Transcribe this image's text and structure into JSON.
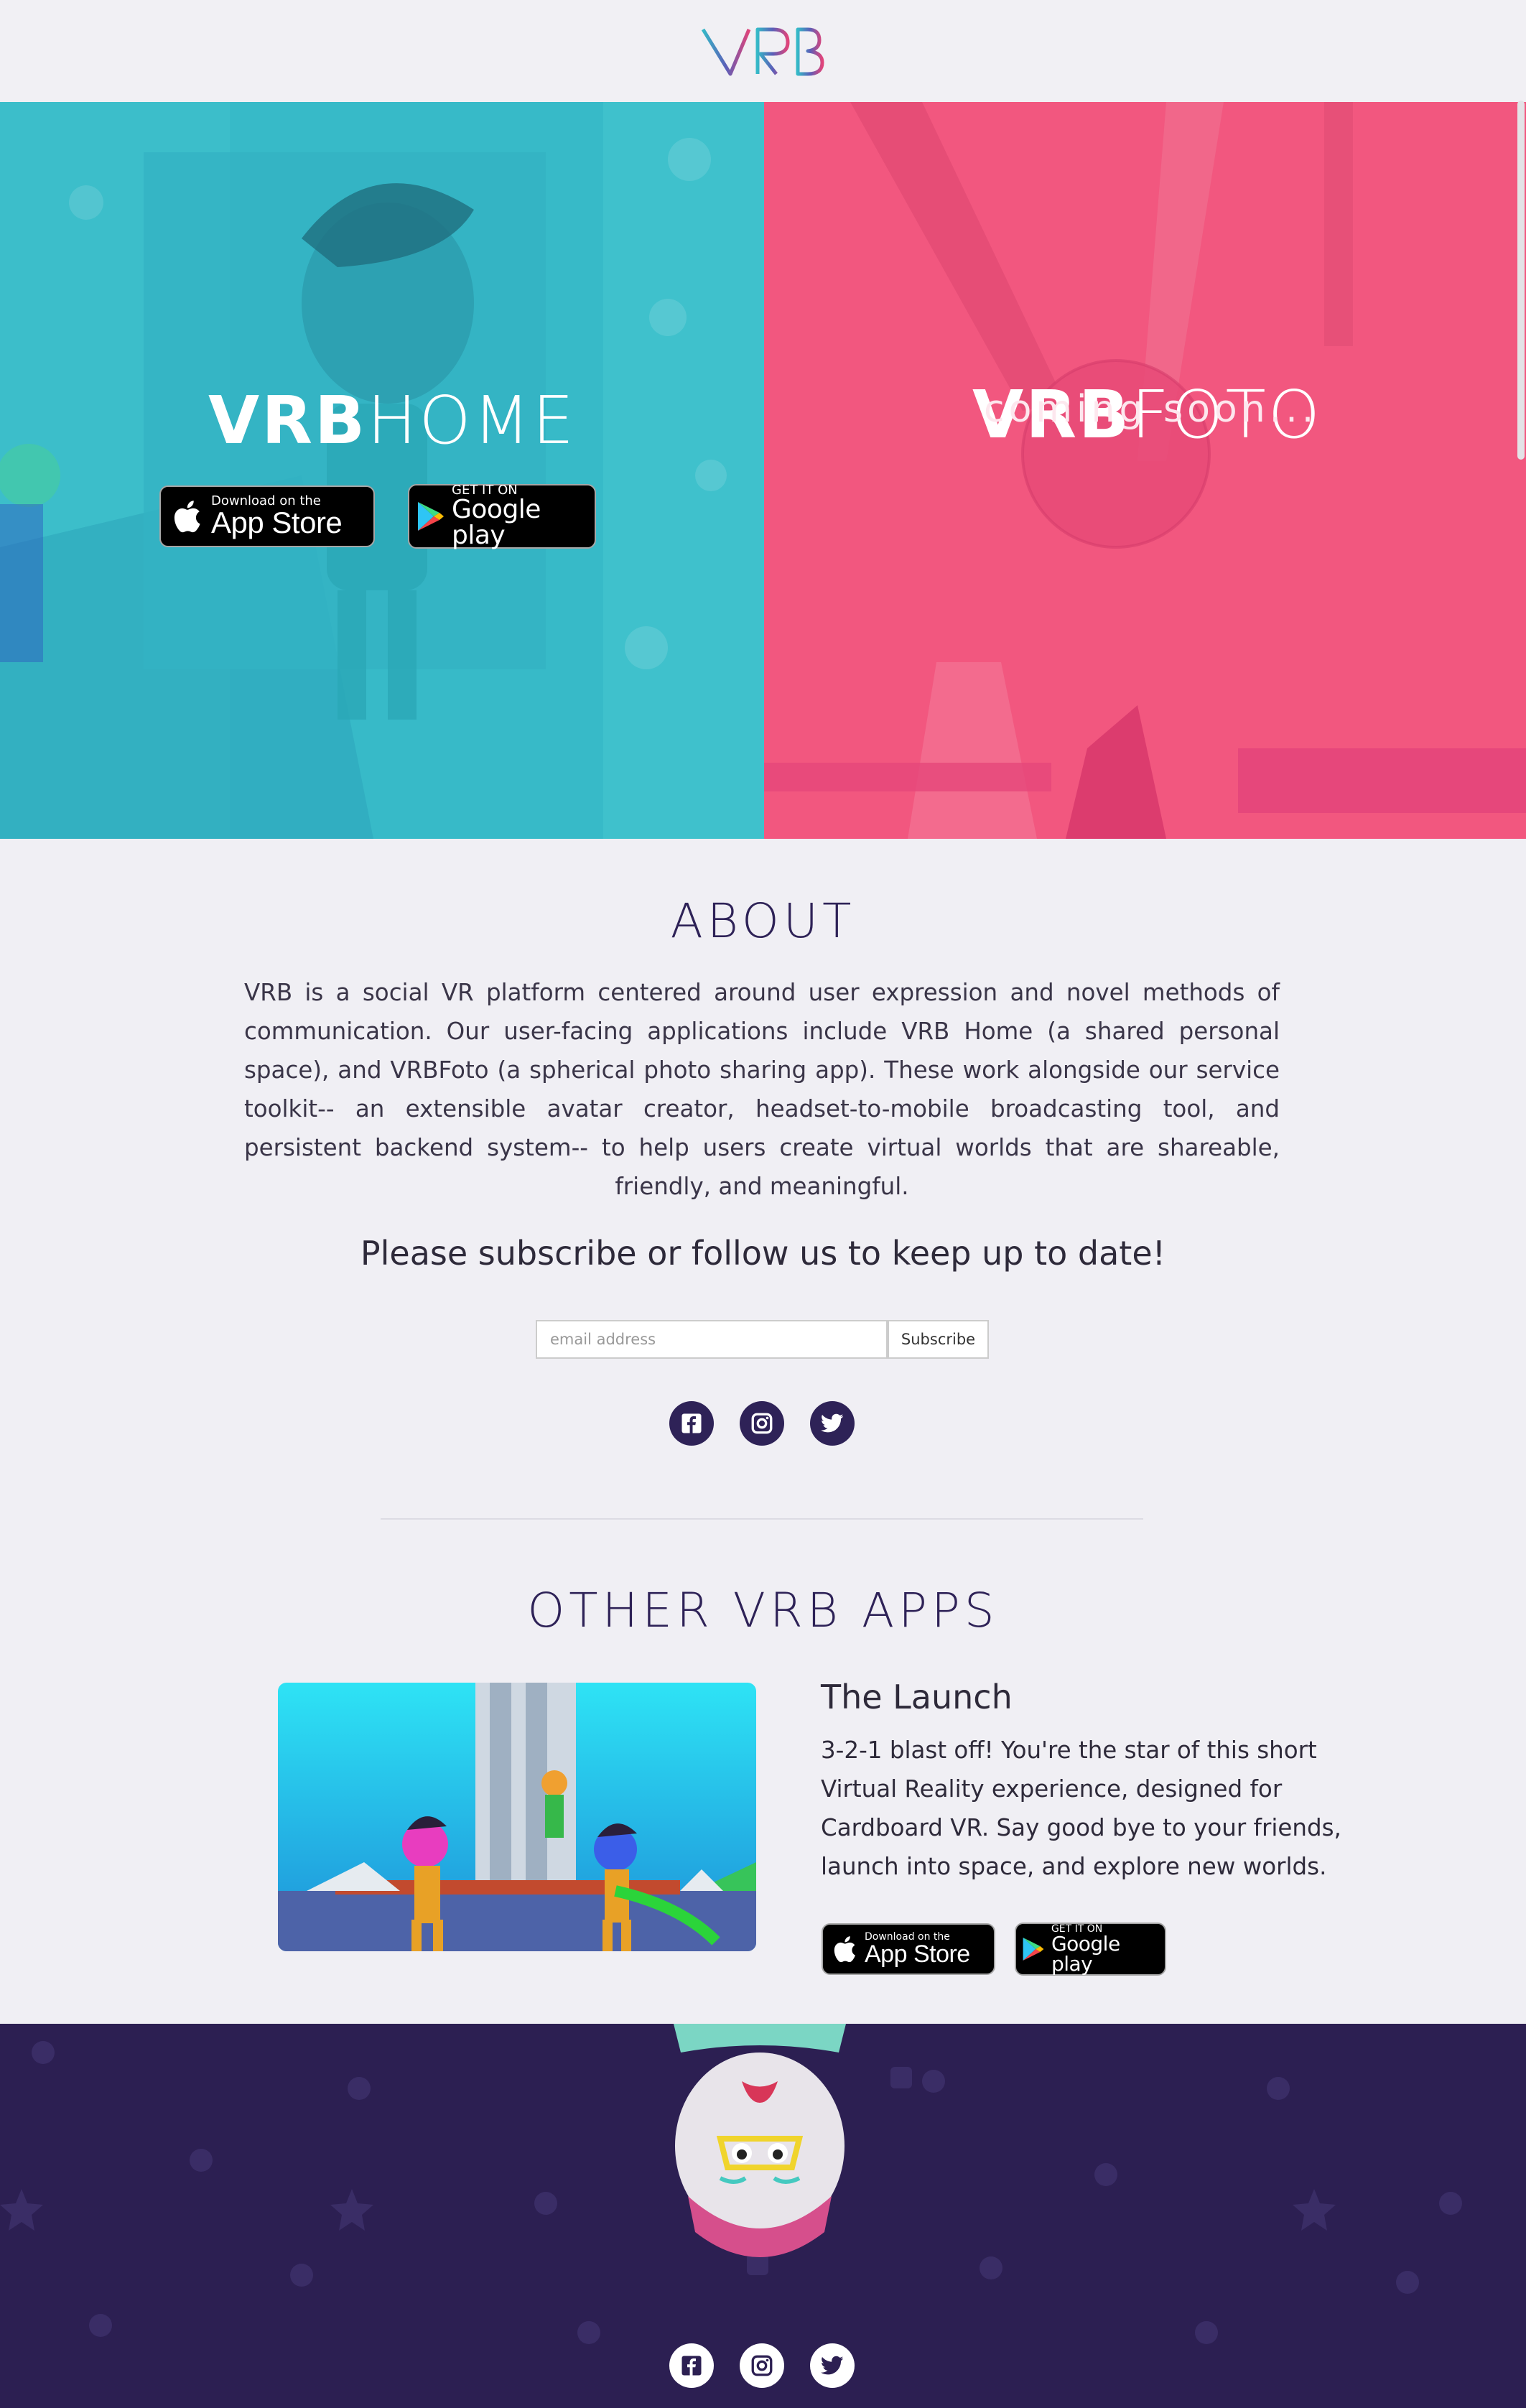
{
  "header": {
    "logo_text": "VRB"
  },
  "hero": {
    "left": {
      "title_bold": "VRB",
      "title_light": "HOME"
    },
    "right": {
      "title_bold": "VRB",
      "title_light": "FOTO",
      "subtitle": "coming soon..."
    },
    "app_store": {
      "small": "Download on the",
      "big": "App Store"
    },
    "google_play": {
      "small": "GET IT ON",
      "big": "Google play"
    }
  },
  "about": {
    "title": "ABOUT",
    "body": "VRB is a social VR platform centered around user expression and novel methods of communication. Our user-facing applications include VRB Home (a shared personal space), and VRBFoto (a spherical photo sharing app). These work alongside our service toolkit-- an extensible avatar creator, headset-to-mobile broadcasting tool, and persistent backend system-- to help users create virtual worlds that are shareable, friendly, and meaningful."
  },
  "subscribe": {
    "title": "Please subscribe or follow us to keep up to date!",
    "placeholder": "email address",
    "button": "Subscribe"
  },
  "social": {
    "icons": [
      "facebook-icon",
      "instagram-icon",
      "twitter-icon"
    ]
  },
  "other_apps": {
    "title": "OTHER VRB APPS",
    "apps": [
      {
        "name": "The Launch",
        "description": "3-2-1 blast off! You're the star of this short Virtual Reality experience, designed for Cardboard VR. Say good bye to your friends, launch into space, and explore new worlds.",
        "app_store": {
          "small": "Download on the",
          "big": "App Store"
        },
        "google_play": {
          "small": "GET IT ON",
          "big": "Google play"
        }
      }
    ]
  },
  "colors": {
    "home_teal": "#35b8c7",
    "foto_pink": "#f2577f",
    "navy": "#2e2257",
    "footer_purple": "#2c1f52",
    "background": "#f0eff4"
  }
}
